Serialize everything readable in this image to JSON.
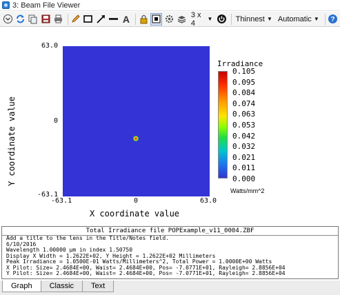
{
  "window": {
    "title": "3: Beam File Viewer"
  },
  "toolbar": {
    "layout_label": "3 x 4",
    "line_style_label": "Thinnest",
    "scale_label": "Automatic",
    "text_tool_label": "A"
  },
  "plot": {
    "y_title": "Y coordinate value",
    "x_title": "X coordinate value",
    "y_ticks": [
      "63.0",
      "0",
      "-63.1"
    ],
    "x_ticks": [
      "-63.1",
      "0",
      "63.0"
    ],
    "colorbar_title": "Irradiance",
    "colorbar_ticks": [
      "0.105",
      "0.095",
      "0.084",
      "0.074",
      "0.063",
      "0.053",
      "0.042",
      "0.032",
      "0.021",
      "0.011",
      "0.000"
    ],
    "colorbar_unit": "Watts/mm^2"
  },
  "chart_data": {
    "type": "heatmap",
    "title": "Irradiance",
    "xlabel": "X coordinate value",
    "ylabel": "Y coordinate value",
    "xlim": [
      -63.1,
      63.0
    ],
    "ylim": [
      -63.1,
      63.0
    ],
    "colorbar_range": [
      0.0,
      0.105
    ],
    "peak": {
      "x": 0,
      "y": 0,
      "value": 0.105
    }
  },
  "info": {
    "title": "Total Irradiance file POPExample_v11_0004.ZBF",
    "lines": [
      "Add a title to the lens in the Title/Notes field.",
      "6/10/2016",
      "Wavelength 1.00000 µm in index 1.50750",
      "Display X Width = 1.2622E+02, Y Height = 1.2622E+02 Millimeters",
      "Peak Irradiance = 1.0500E-01 Watts/Millimeters^2, Total Power = 1.0000E+00 Watts",
      "X Pilot: Size= 2.4684E+00, Waist= 2.4684E+00, Pos= -7.0771E+01, Rayleigh= 2.8856E+04",
      "Y Pilot: Size= 2.4684E+00, Waist= 2.4684E+00, Pos= -7.0771E+01, Rayleigh= 2.8856E+04"
    ]
  },
  "tabs": [
    "Graph",
    "Classic",
    "Text"
  ],
  "colors": {
    "map_background": "#3333d6",
    "accent": "#2a7fd4"
  }
}
